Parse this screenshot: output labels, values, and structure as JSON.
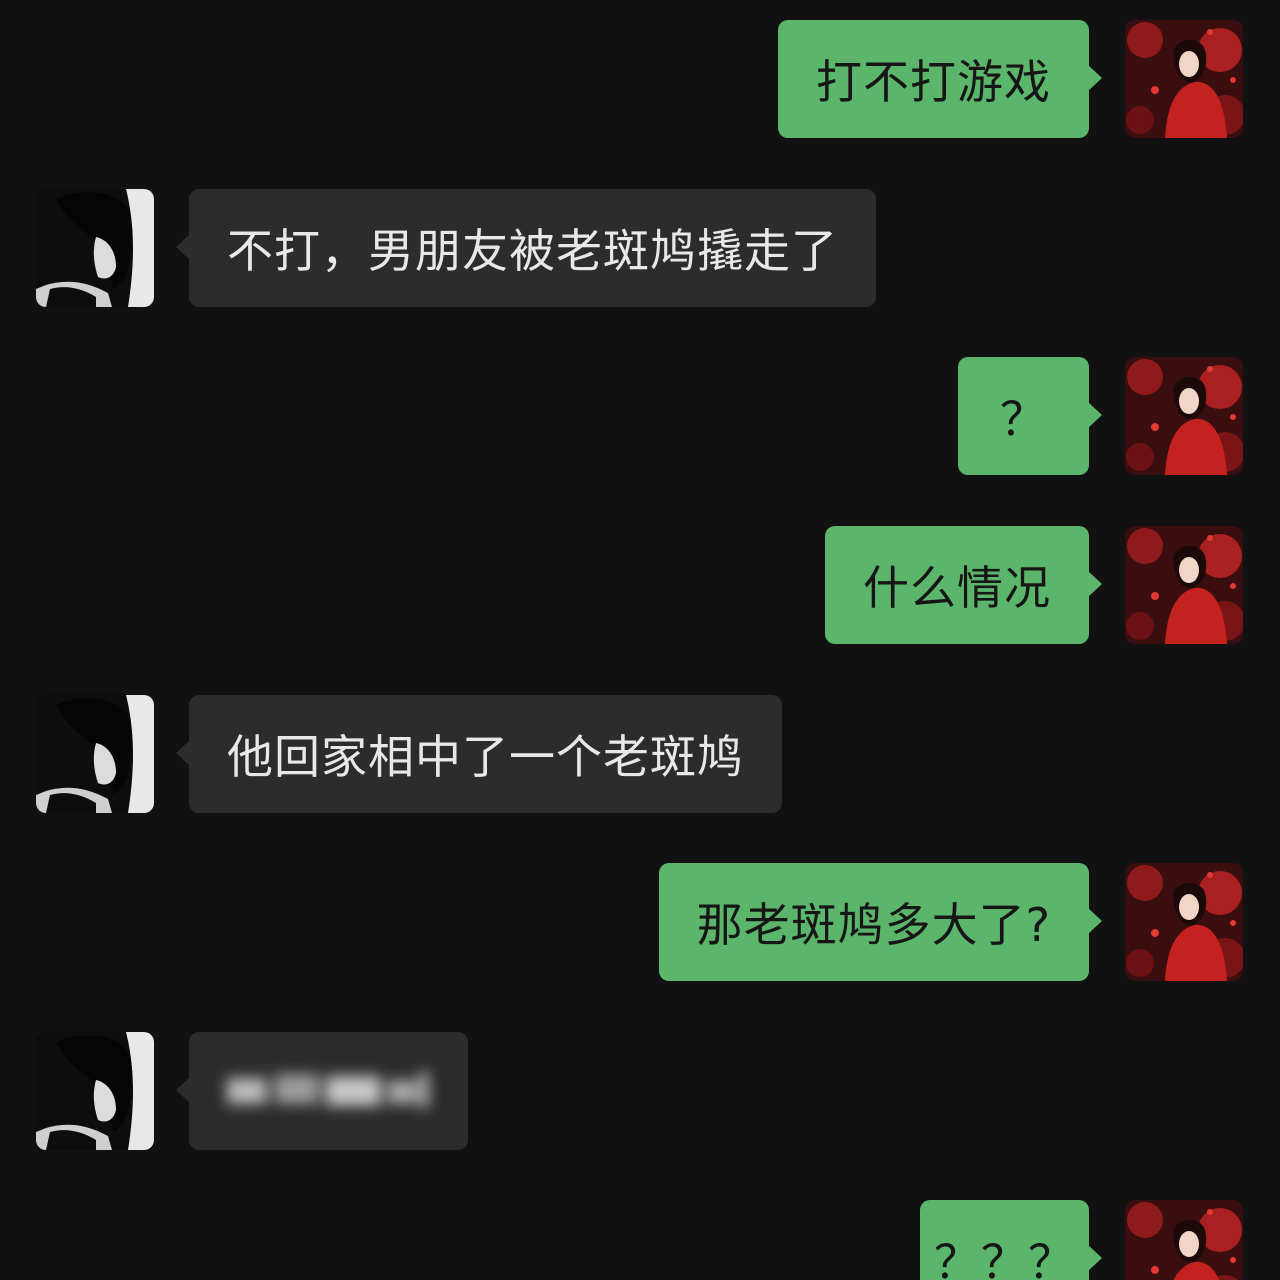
{
  "conversation": {
    "messages": [
      {
        "side": "right",
        "text": "打不打游戏"
      },
      {
        "side": "left",
        "text": "不打，男朋友被老斑鸠撬走了"
      },
      {
        "side": "right",
        "text": "？"
      },
      {
        "side": "right",
        "text": "什么情况"
      },
      {
        "side": "left",
        "text": "他回家相中了一个老斑鸠"
      },
      {
        "side": "right",
        "text": "那老斑鸠多大了?"
      },
      {
        "side": "left",
        "text": "",
        "redacted": true
      },
      {
        "side": "right",
        "text": "？？？"
      }
    ]
  },
  "colors": {
    "background": "#111111",
    "outgoing_bubble": "#5bb56a",
    "incoming_bubble": "#2c2c2c"
  },
  "icons": {
    "self_avatar": "red-dress-woman-avatar",
    "contact_avatar": "monochrome-woman-avatar"
  }
}
